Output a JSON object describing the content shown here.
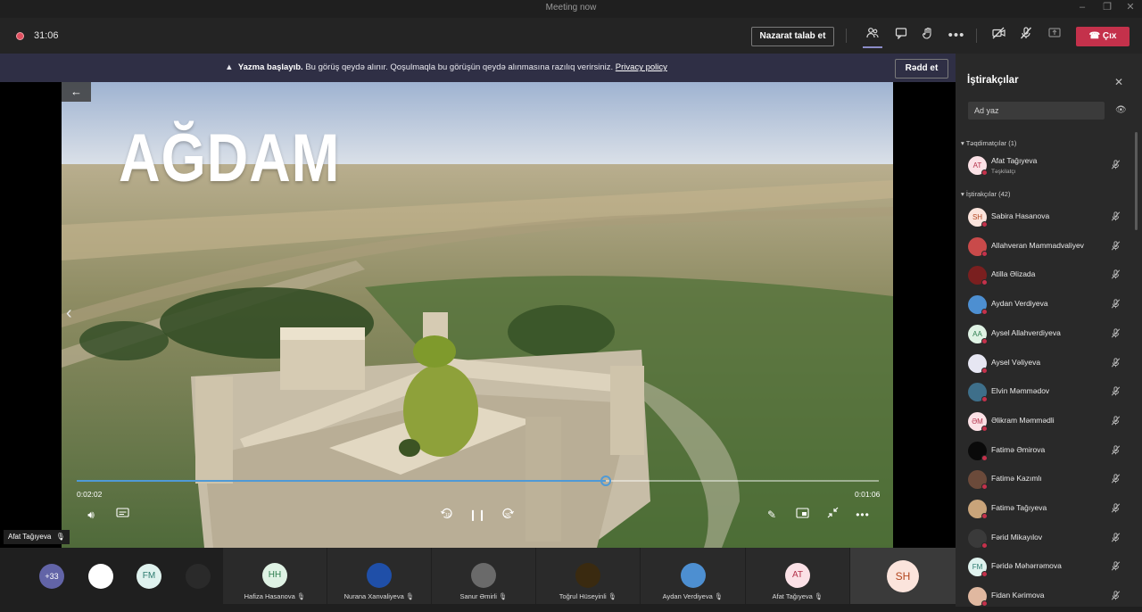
{
  "window": {
    "title": "Meeting now"
  },
  "toolbar": {
    "timer": "31:06",
    "request_control": "Nazarat talab et",
    "leave": "Çıx"
  },
  "banner": {
    "bold": "Yazma başlayıb.",
    "text": " Bu görüş qeydə alınır. Qoşulmaqla bu görüşün qeydə alınmasına razılıq verirsiniz. ",
    "link": "Privacy policy",
    "dismiss": "Rədd et"
  },
  "video": {
    "title": "AĞDAM",
    "elapsed": "0:02:02",
    "remaining": "0:01:06",
    "progress_fraction": 0.66
  },
  "presenter_label": "Afat Tağıyeva",
  "strip": {
    "more_count": "+33",
    "small_avatars": [
      {
        "initials": "",
        "bg": "#ffffff"
      },
      {
        "initials": "FM",
        "bg": "#dff2ee",
        "fg": "#2b7a6e"
      },
      {
        "initials": "",
        "bg": "#2a2a2a"
      }
    ],
    "tiles": [
      {
        "name": "Hafiza Hasanova",
        "initials": "HH",
        "bg": "#dff2e4",
        "fg": "#2e7d4f"
      },
      {
        "name": "Nurana Xanvaliyeva",
        "initials": "",
        "bg": "#1f4fa8"
      },
      {
        "name": "Sanur Əmirli",
        "initials": "",
        "bg": "#6a6a6a"
      },
      {
        "name": "Toğrul Hüseyinli",
        "initials": "",
        "bg": "#3a2a10"
      },
      {
        "name": "Aydan Verdiyeva",
        "initials": "",
        "bg": "#4d8fd1"
      },
      {
        "name": "Afat Tağıyeva",
        "initials": "AT",
        "bg": "#fbe1e6",
        "fg": "#b4324b"
      },
      {
        "name": "",
        "initials": "SH",
        "bg": "#fbe4dc",
        "fg": "#b3461f"
      }
    ]
  },
  "sidebar": {
    "title": "İştirakçılar",
    "search_placeholder": "Ad yaz",
    "presenters_header": "Təqdimatçılar (1)",
    "attendees_header": "İştirakçılar (42)",
    "presenters": [
      {
        "name": "Afat Tağıyeva",
        "role": "Təşkilatçı",
        "initials": "AT",
        "bg": "#fbe1e6",
        "fg": "#b4324b"
      }
    ],
    "attendees": [
      {
        "name": "Sabira Hasanova",
        "initials": "SH",
        "bg": "#fbe4dc",
        "fg": "#b3461f"
      },
      {
        "name": "Allahveran Mammadvaliyev",
        "initials": "",
        "bg": "#c94a4a"
      },
      {
        "name": "Atilla Əlizada",
        "initials": "",
        "bg": "#7a1f1f"
      },
      {
        "name": "Aydan Verdiyeva",
        "initials": "",
        "bg": "#4d8fd1"
      },
      {
        "name": "Aysel Allahverdiyeva",
        "initials": "AA",
        "bg": "#dff2e4",
        "fg": "#2e7d4f"
      },
      {
        "name": "Aysel Vəliyeva",
        "initials": "",
        "bg": "#e6e6f2"
      },
      {
        "name": "Elvin Məmmədov",
        "initials": "",
        "bg": "#3e6f8a"
      },
      {
        "name": "Əlikram Məmmədli",
        "initials": "ƏM",
        "bg": "#fbe1e6",
        "fg": "#b4324b"
      },
      {
        "name": "Fatimə Əmirova",
        "initials": "",
        "bg": "#0a0a0a"
      },
      {
        "name": "Fatimə Kazımlı",
        "initials": "",
        "bg": "#6b4a3a"
      },
      {
        "name": "Fatimə Tağıyeva",
        "initials": "",
        "bg": "#c9a47a"
      },
      {
        "name": "Fərid Mikayılov",
        "initials": "",
        "bg": "#3a3a3a"
      },
      {
        "name": "Fəridə Məhərrəmova",
        "initials": "FM",
        "bg": "#dff2ee",
        "fg": "#2b7a6e"
      },
      {
        "name": "Fidan Kərimova",
        "initials": "",
        "bg": "#e0b8a0"
      }
    ]
  },
  "colors": {
    "accent": "#4f9ad6",
    "leave": "#c4314b",
    "banner_bg": "#2f2f45"
  }
}
